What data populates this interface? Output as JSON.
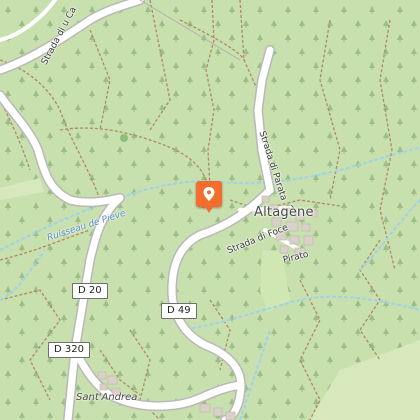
{
  "map": {
    "colors": {
      "forest": "#c8dfae",
      "road": "#ffffff",
      "road_casing": "#b9b9b9",
      "stream": "#9fd3ea",
      "track": "#b08a5f",
      "building": "#d9d0c9",
      "meadow": "#d7e9bc",
      "marker": "#f36d2c"
    },
    "places": {
      "town": "Altagène",
      "village": "Sant'Andrea"
    },
    "roads": {
      "d20": "D 20",
      "d49": "D 49",
      "d320": "D 320"
    },
    "streets": {
      "u_ca": "Strada di u Ca",
      "parata": "Strada di Parata",
      "foce": "Strada di Foce",
      "pirato": "Pirato"
    },
    "waterways": {
      "ruisseau": "Ruisseau de Pieve"
    },
    "marker": {
      "icon": "location-pin-icon"
    }
  }
}
